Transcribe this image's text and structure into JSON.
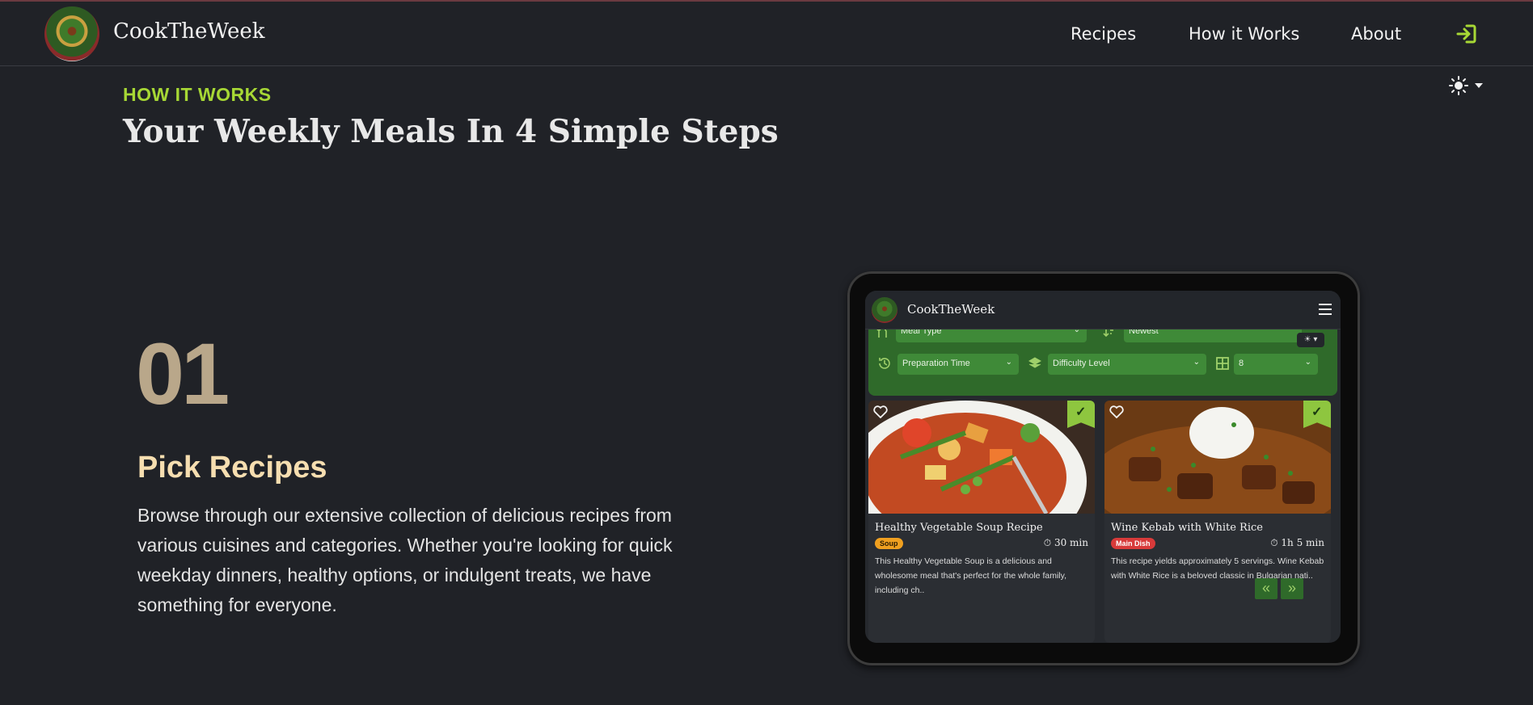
{
  "header": {
    "brand": "CookTheWeek",
    "nav": [
      "Recipes",
      "How it Works",
      "About"
    ]
  },
  "section": {
    "eyebrow": "HOW IT WORKS",
    "heading": "Your Weekly Meals In 4 Simple Steps"
  },
  "step": {
    "number": "01",
    "title": "Pick Recipes",
    "description": "Browse through our extensive collection of delicious recipes from various cuisines and categories. Whether you're looking for quick weekday dinners, healthy options, or indulgent treats, we have something for everyone."
  },
  "device": {
    "brand": "CookTheWeek",
    "filters": {
      "meal_type": "Meal Type",
      "sort": "Newest",
      "prep_time": "Preparation Time",
      "difficulty": "Difficulty Level",
      "per_page": "8"
    },
    "cards": [
      {
        "title": "Healthy Vegetable Soup Recipe",
        "badge": "Soup",
        "time": "30 min",
        "description": "This Healthy Vegetable Soup is a delicious and wholesome meal that's perfect for the whole family, including ch.."
      },
      {
        "title": "Wine Kebab with White Rice",
        "badge": "Main Dish",
        "time": "1h 5 min",
        "description": "This recipe yields approximately 5 servings. Wine Kebab with White Rice is a beloved classic in Bulgarian nati.."
      }
    ],
    "pager": {
      "prev": "«",
      "next": "»"
    }
  },
  "colors": {
    "accent_green": "#a7d835",
    "step_number": "#b9a78a",
    "step_title": "#f6deb0",
    "soup_badge": "#f0a020",
    "main_dish_badge": "#d83a3a"
  },
  "icons": [
    "login-icon",
    "sun-icon",
    "menu-icon",
    "heart-icon",
    "check-icon",
    "utensils-icon",
    "sort-icon",
    "history-icon",
    "layers-icon",
    "grid-icon",
    "stopwatch-icon"
  ]
}
